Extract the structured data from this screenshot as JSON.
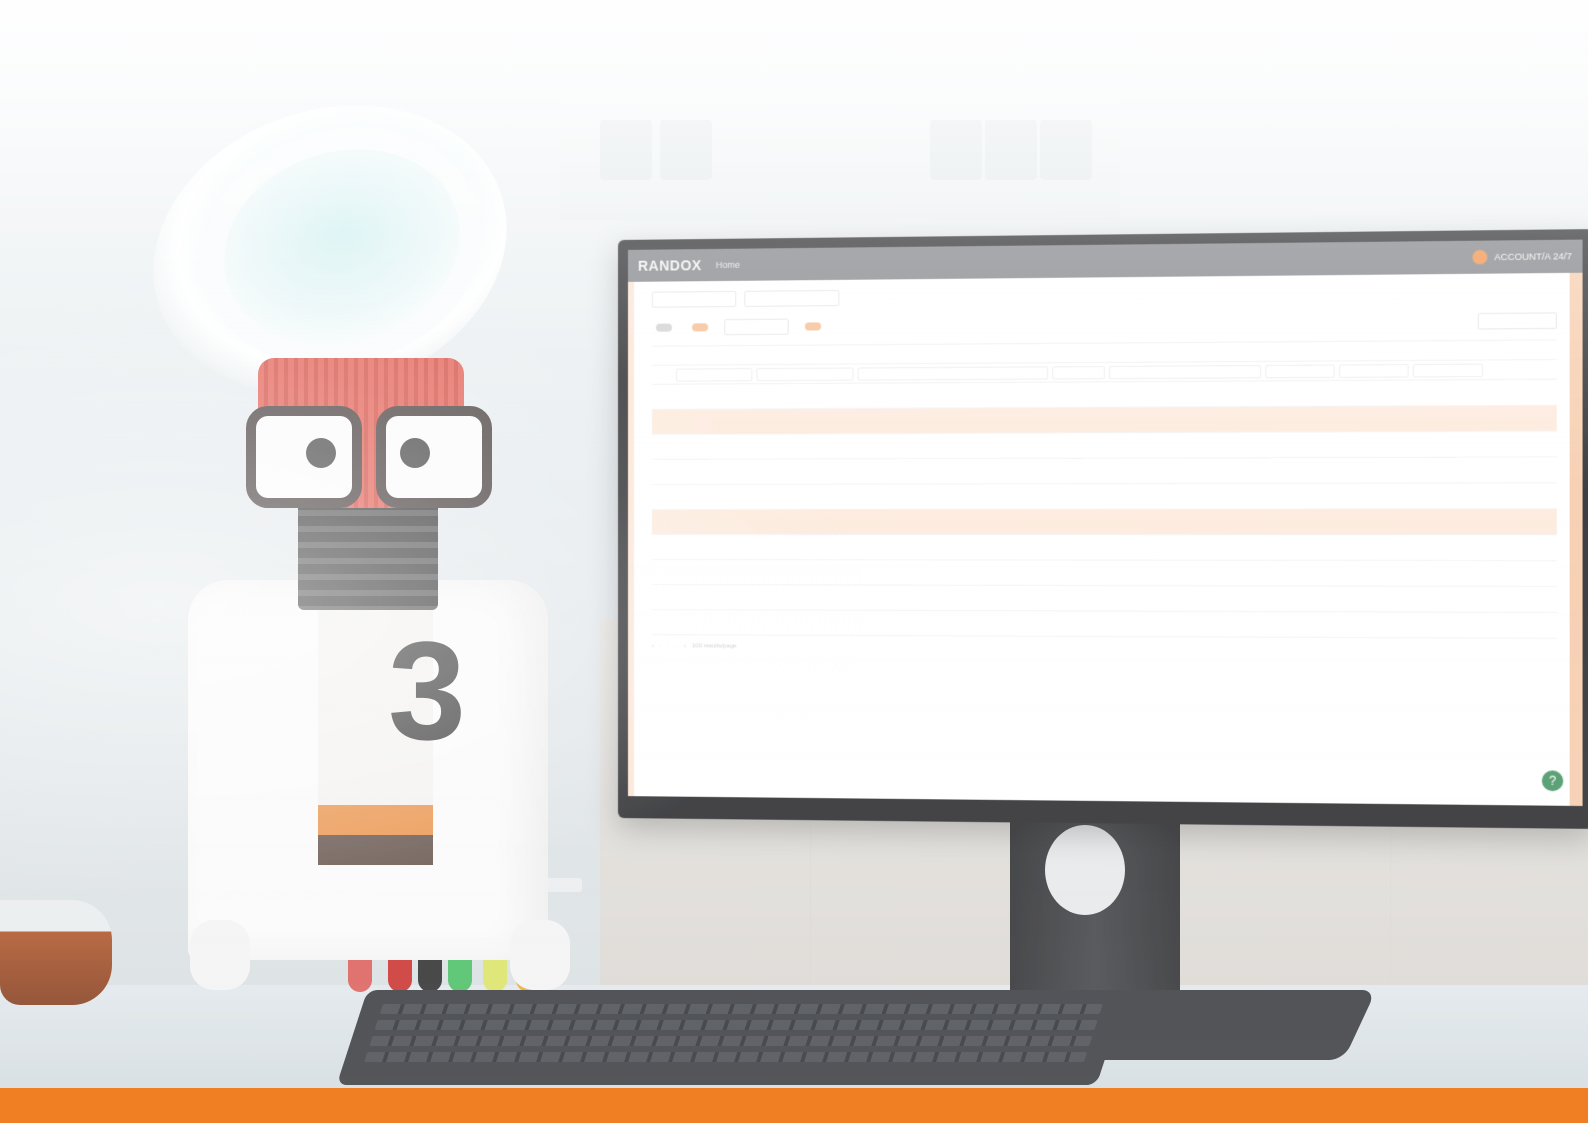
{
  "colors": {
    "accent": "#f07f24",
    "highlight_row": "#fde9da",
    "topbar": "#7a7c80",
    "help_button": "#3b8f5a"
  },
  "screen": {
    "brand": "RANDOX",
    "nav_home": "Home",
    "account_label": "ACCOUNT/A 24/7",
    "help_icon": "?",
    "pager_text": "100 results/page"
  },
  "icons": [
    "avatar-icon",
    "help-icon",
    "checkbox-icon",
    "kebab-menu-icon"
  ]
}
